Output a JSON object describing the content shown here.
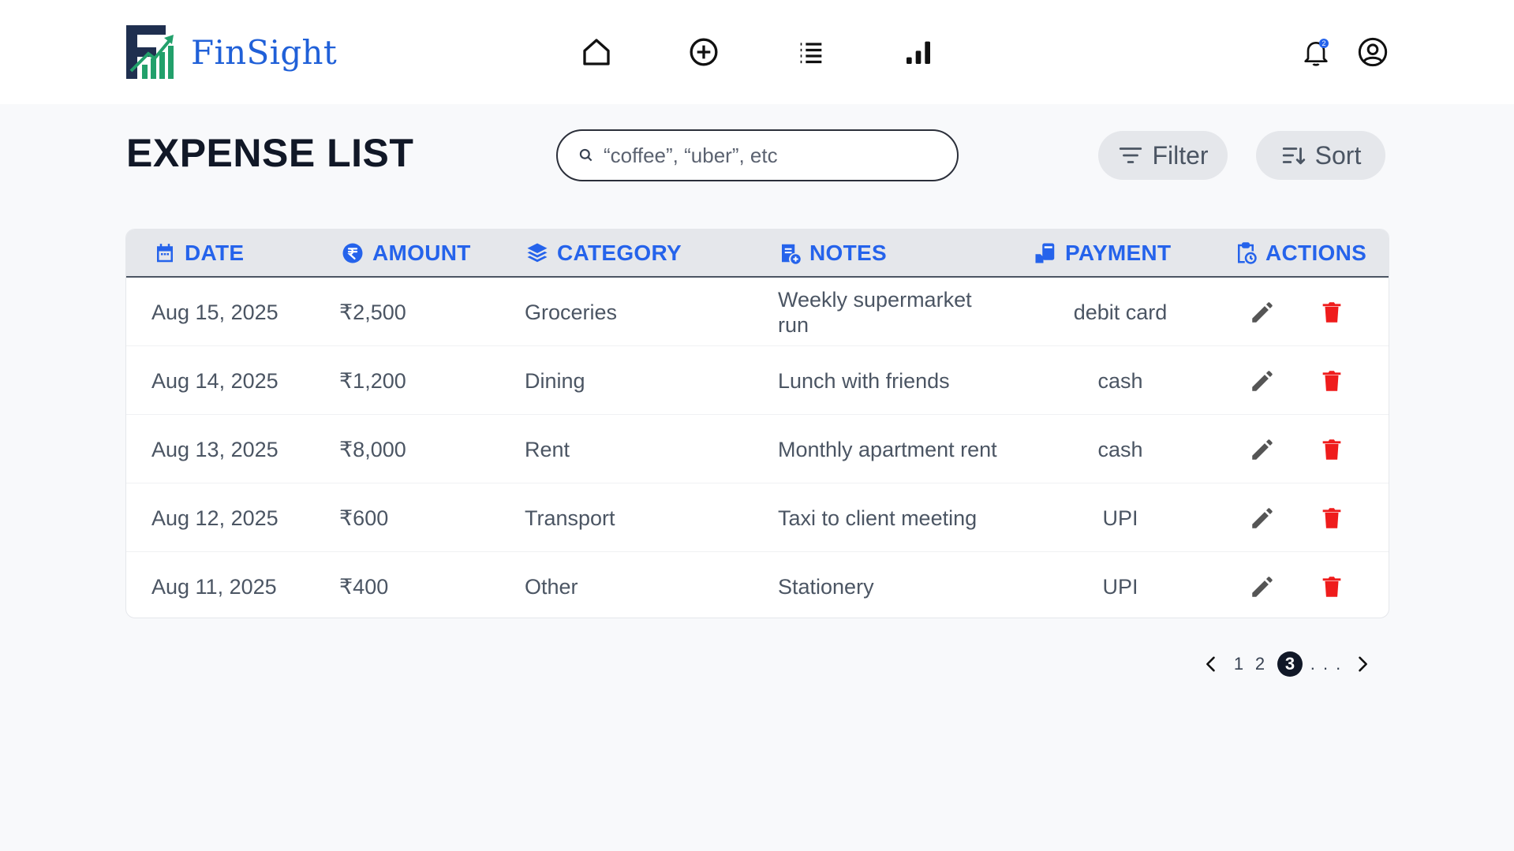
{
  "brand": {
    "name": "FinSight"
  },
  "nav": {
    "icons": [
      "home-icon",
      "add-circle-icon",
      "list-icon",
      "bar-chart-icon"
    ],
    "notification_badge": "2"
  },
  "page": {
    "title": "EXPENSE LIST"
  },
  "search": {
    "placeholder": "“coffee”, “uber”, etc"
  },
  "toolbar": {
    "filter_label": "Filter",
    "sort_label": "Sort"
  },
  "table": {
    "headers": {
      "date": "DATE",
      "amount": "AMOUNT",
      "category": "CATEGORY",
      "notes": "NOTES",
      "payment": "PAYMENT",
      "actions": "ACTIONS"
    },
    "rows": [
      {
        "date": "Aug 15, 2025",
        "amount": "₹2,500",
        "category": "Groceries",
        "notes": "Weekly supermarket run",
        "payment": "debit card"
      },
      {
        "date": "Aug 14, 2025",
        "amount": "₹1,200",
        "category": "Dining",
        "notes": "Lunch with friends",
        "payment": "cash"
      },
      {
        "date": "Aug 13, 2025",
        "amount": "₹8,000",
        "category": "Rent",
        "notes": "Monthly apartment rent",
        "payment": "cash"
      },
      {
        "date": "Aug 12, 2025",
        "amount": "₹600",
        "category": "Transport",
        "notes": "Taxi to client meeting",
        "payment": "UPI"
      },
      {
        "date": "Aug 11, 2025",
        "amount": "₹400",
        "category": "Other",
        "notes": "Stationery",
        "payment": "UPI"
      }
    ]
  },
  "pagination": {
    "pages": [
      "1",
      "2",
      "3"
    ],
    "current": "3",
    "ellipsis": ". . ."
  },
  "colors": {
    "brand_blue": "#2060d8",
    "header_blue": "#2563eb",
    "logo_green": "#22a06b",
    "delete_red": "#ef1c1c",
    "dark": "#111827"
  }
}
